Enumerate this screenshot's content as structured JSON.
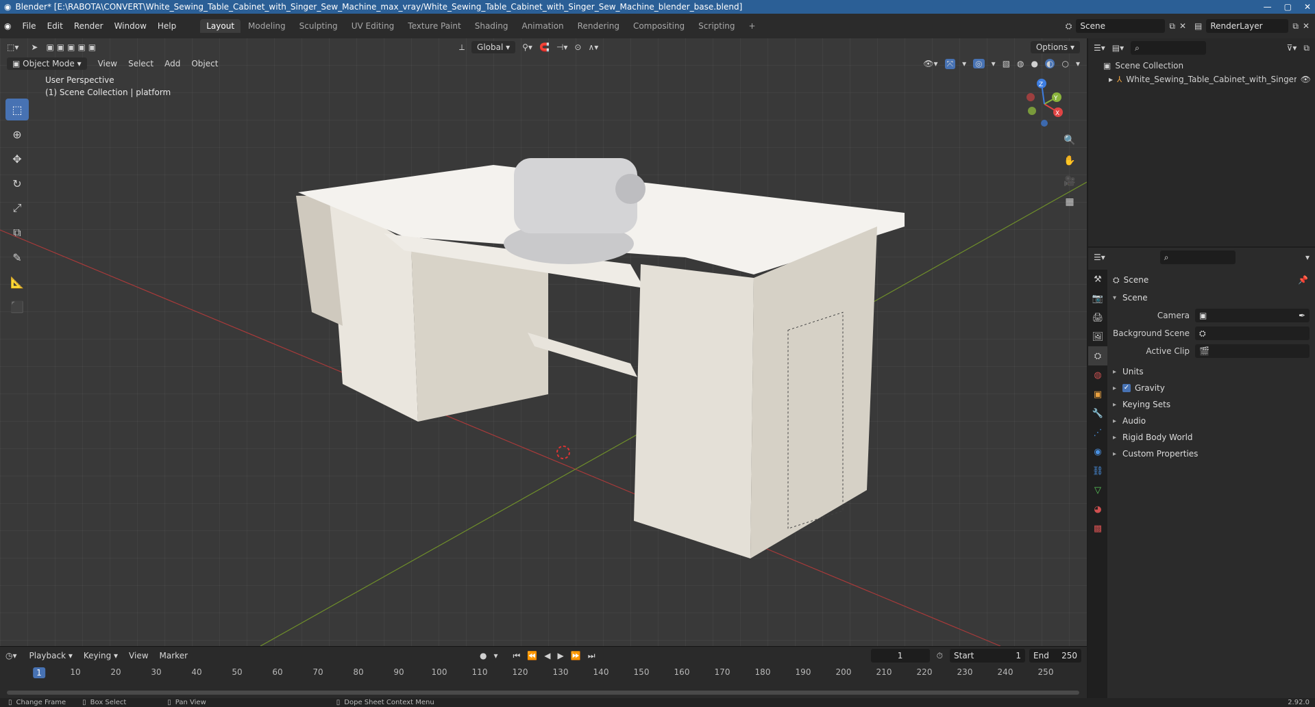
{
  "window": {
    "title": "Blender* [E:\\RABOTA\\CONVERT\\White_Sewing_Table_Cabinet_with_Singer_Sew_Machine_max_vray/White_Sewing_Table_Cabinet_with_Singer_Sew_Machine_blender_base.blend]"
  },
  "menu": [
    "File",
    "Edit",
    "Render",
    "Window",
    "Help"
  ],
  "workspaces": [
    "Layout",
    "Modeling",
    "Sculpting",
    "UV Editing",
    "Texture Paint",
    "Shading",
    "Animation",
    "Rendering",
    "Compositing",
    "Scripting"
  ],
  "workspace_add": "+",
  "scene_field": "Scene",
  "renderlayer_field": "RenderLayer",
  "viewport": {
    "transform": "Global",
    "options": "Options",
    "mode": "Object Mode",
    "menus": [
      "View",
      "Select",
      "Add",
      "Object"
    ],
    "perspective": "User Perspective",
    "collection_info": "(1) Scene Collection | platform",
    "gizmo": {
      "x": "X",
      "y": "Y",
      "z": "Z"
    }
  },
  "outliner": {
    "root": "Scene Collection",
    "item": "White_Sewing_Table_Cabinet_with_Singer_S"
  },
  "properties": {
    "context": "Scene",
    "panel": "Scene",
    "camera_label": "Camera",
    "background_scene_label": "Background Scene",
    "active_clip_label": "Active Clip",
    "sections": [
      "Units",
      "Gravity",
      "Keying Sets",
      "Audio",
      "Rigid Body World",
      "Custom Properties"
    ]
  },
  "timeline": {
    "menus": [
      "Playback",
      "Keying",
      "View",
      "Marker"
    ],
    "current_frame": "1",
    "start_label": "Start",
    "start": "1",
    "end_label": "End",
    "end": "250",
    "ticks": [
      "10",
      "20",
      "30",
      "40",
      "50",
      "60",
      "70",
      "80",
      "90",
      "100",
      "110",
      "120",
      "130",
      "140",
      "150",
      "160",
      "170",
      "180",
      "190",
      "200",
      "210",
      "220",
      "230",
      "240",
      "250"
    ],
    "cursor": "1"
  },
  "statusbar": {
    "items": [
      "Change Frame",
      "Box Select",
      "Pan View",
      "Dope Sheet Context Menu"
    ],
    "version": "2.92.0"
  }
}
